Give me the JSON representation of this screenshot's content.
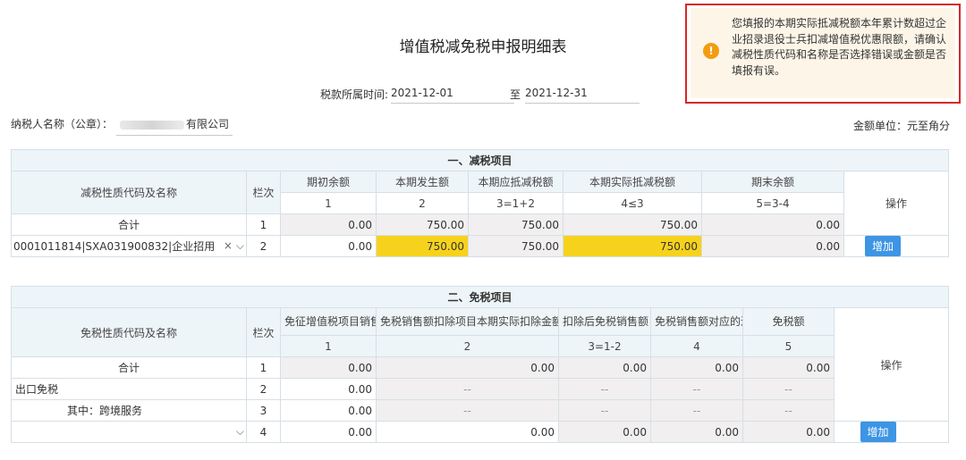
{
  "page": {
    "title": "增值税减免税申报明细表",
    "period_label": "税款所属时间:",
    "period_start": "2021-12-01",
    "period_to": "至",
    "period_end": "2021-12-31",
    "payer_label": "纳税人名称（公章）：",
    "payer_name_visible": "有限公司",
    "unit_label": "金额单位：元至角分"
  },
  "alert": {
    "icon": "warning-icon",
    "message": "您填报的本期实际抵减税额本年累计数超过企业招录退役士兵扣减增值税优惠限额，请确认减税性质代码和名称是否选择错误或金额是否填报有误。",
    "border_color": "#d9262a",
    "background": "#fdf6e8"
  },
  "reduction": {
    "section_title": "一、减税项目",
    "headers": {
      "name": "减税性质代码及名称",
      "line": "栏次",
      "op": "操作",
      "cols": [
        "期初余额",
        "本期发生额",
        "本期应抵减税额",
        "本期实际抵减税额",
        "期末余额"
      ],
      "formulas": [
        "1",
        "2",
        "3=1+2",
        "4≤3",
        "5=3-4"
      ]
    },
    "total": {
      "label": "合计",
      "line": "1",
      "values": [
        "0.00",
        "750.00",
        "750.00",
        "750.00",
        "0.00"
      ]
    },
    "row": {
      "select_value": "0001011814|SXA031900832|企业招用",
      "clear_icon": "×",
      "line": "2",
      "values": [
        "0.00",
        "750.00",
        "750.00",
        "750.00",
        "0.00"
      ],
      "add_label": "增加"
    }
  },
  "exemption": {
    "section_title": "二、免税项目",
    "headers": {
      "name": "免税性质代码及名称",
      "line": "栏次",
      "op": "操作",
      "cols": [
        "免征增值税项目销售额",
        "免税销售额扣除项目本期实际扣除金额",
        "扣除后免税销售额",
        "免税销售额对应的进项税额",
        "免税额"
      ],
      "formulas": [
        "1",
        "2",
        "3=1-2",
        "4",
        "5"
      ]
    },
    "rows": [
      {
        "label": "合计",
        "line": "1",
        "values": [
          "0.00",
          "0.00",
          "0.00",
          "0.00",
          "0.00"
        ]
      },
      {
        "label": "出口免税",
        "line": "2",
        "values": [
          "0.00",
          "--",
          "--",
          "--",
          "--"
        ]
      },
      {
        "label": "其中：跨境服务",
        "line": "3",
        "values": [
          "0.00",
          "--",
          "--",
          "--",
          "--"
        ]
      }
    ],
    "input_row": {
      "line": "4",
      "values": [
        "0.00",
        "0.00",
        "0.00",
        "0.00",
        "0.00"
      ],
      "add_label": "增加"
    }
  },
  "colors": {
    "header_bg": "#eef5f9",
    "readonly_bg": "#f1eff0",
    "highlight": "#f7d21c",
    "button": "#3d95e4"
  }
}
